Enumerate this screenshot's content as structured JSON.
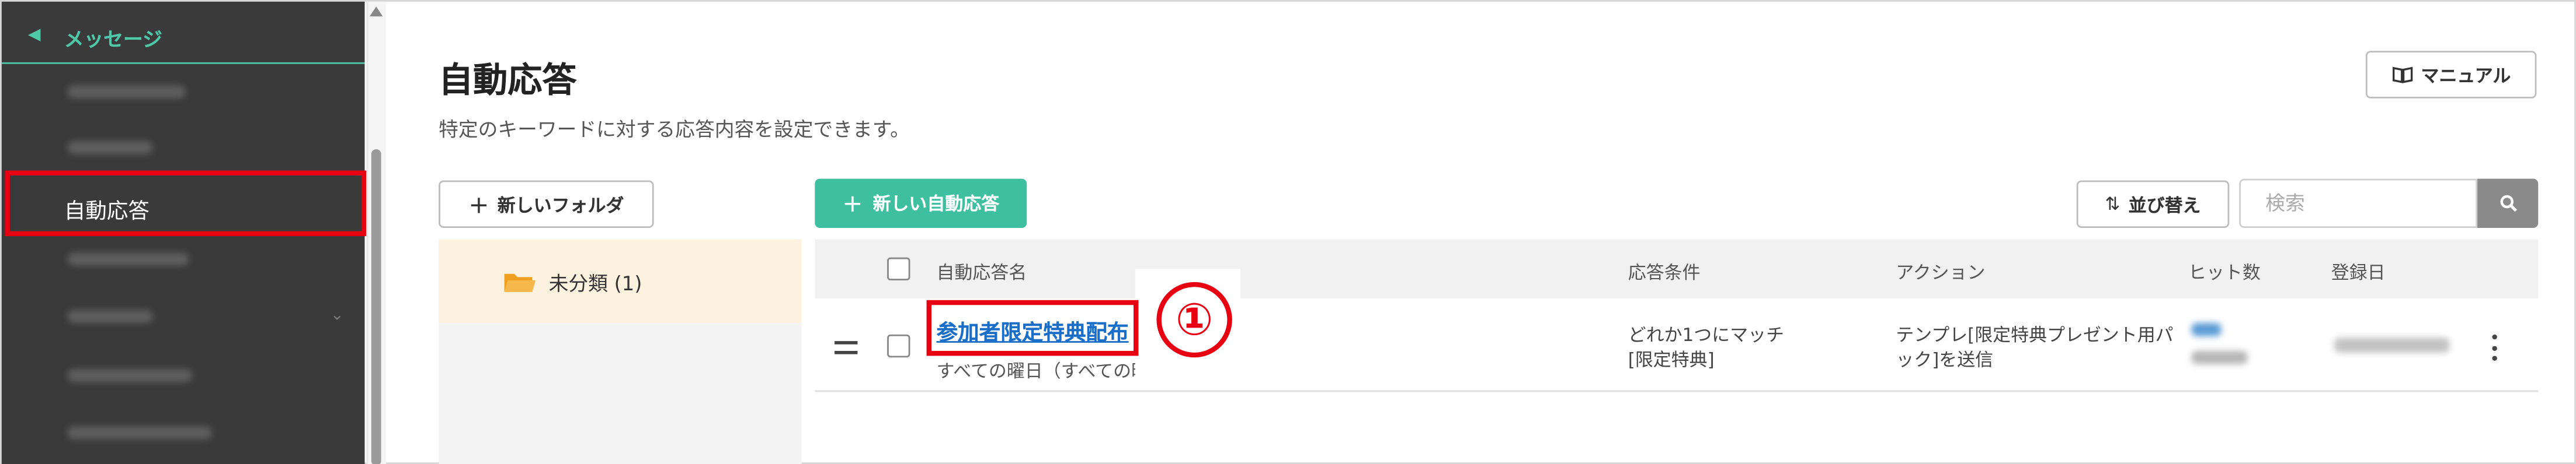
{
  "colors": {
    "sidebar_bg": "#3a3a3a",
    "accent_green": "#3dbfa0",
    "highlight_red": "#e60012",
    "link_blue": "#1a6ec7",
    "folder_active_bg": "#fdf2e0"
  },
  "sidebar": {
    "section_icon": "megaphone-icon",
    "section_label": "メッセージ",
    "active_item": "自動応答"
  },
  "page": {
    "title": "自動応答",
    "subtitle": "特定のキーワードに対する応答内容を設定できます。"
  },
  "toolbar": {
    "manual_label": "マニュアル",
    "new_folder_label": "新しいフォルダ",
    "new_auto_label": "新しい自動応答",
    "sort_label": "並び替え",
    "search_placeholder": "検索"
  },
  "folders": [
    {
      "label": "未分類 (1)",
      "icon": "folder-icon"
    }
  ],
  "table": {
    "headers": {
      "name": "自動応答名",
      "condition": "応答条件",
      "action": "アクション",
      "hits": "ヒット数",
      "registered": "登録日"
    },
    "rows": [
      {
        "name": "参加者限定特典配布",
        "schedule": "すべての曜日（すべての時",
        "condition_line1": "どれか1つにマッチ",
        "condition_line2": "[限定特典]",
        "action": "テンプレ[限定特典プレゼント用パック]を送信"
      }
    ]
  },
  "annotation": {
    "marker": "①"
  }
}
